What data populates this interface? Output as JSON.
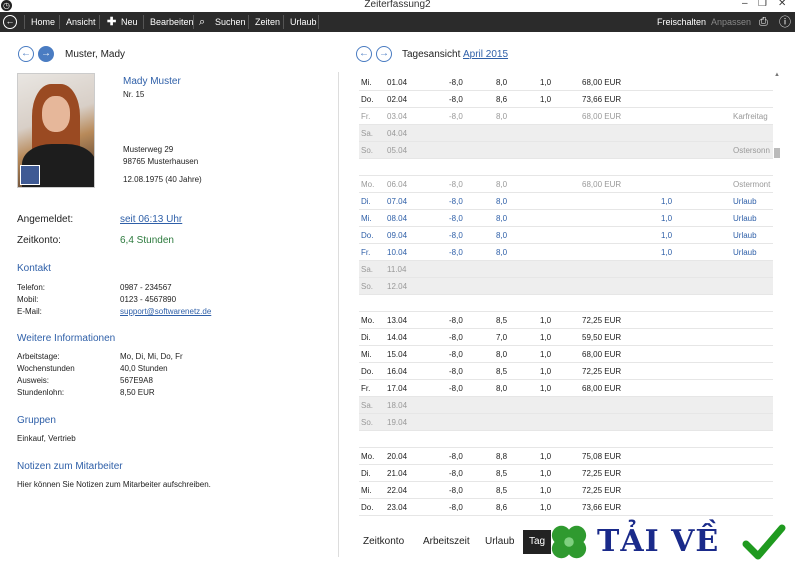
{
  "window": {
    "title": "Zeiterfassung2",
    "app_icon": "clock-icon"
  },
  "toolbar": {
    "items": [
      "Home",
      "Ansicht",
      "Neu",
      "Bearbeiten",
      "Suchen",
      "Zeiten",
      "Urlaub"
    ],
    "right": [
      "Freischalten",
      "Anpassen"
    ]
  },
  "employee": {
    "name_header": "Muster, Mady",
    "display_name": "Mady Muster",
    "number": "Nr. 15",
    "street": "Musterweg 29",
    "city": "98765 Musterhausen",
    "birthday": "12.08.1975 (40 Jahre)",
    "logged_in_label": "Angemeldet:",
    "logged_in_value": "seit 06:13 Uhr",
    "account_label": "Zeitkonto:",
    "account_value": "6,4 Stunden"
  },
  "contact": {
    "heading": "Kontakt",
    "phone_label": "Telefon:",
    "phone": "0987 - 234567",
    "mobile_label": "Mobil:",
    "mobile": "0123 - 4567890",
    "email_label": "E-Mail:",
    "email": "support@softwarenetz.de"
  },
  "info": {
    "heading": "Weitere Informationen",
    "days_label": "Arbeitstage:",
    "days": "Mo, Di, Mi, Do, Fr",
    "hours_label": "Wochenstunden",
    "hours": "40,0 Stunden",
    "id_label": "Ausweis:",
    "id": "567E9A8",
    "wage_label": "Stundenlohn:",
    "wage": "8,50 EUR"
  },
  "groups": {
    "heading": "Gruppen",
    "value": "Einkauf, Vertrieb"
  },
  "notes": {
    "heading": "Notizen zum Mitarbeiter",
    "value": "Hier können Sie Notizen zum Mitarbeiter aufschreiben."
  },
  "dayview": {
    "label": "Tagesansicht",
    "month": "April 2015"
  },
  "rows": [
    {
      "d": "Mi.",
      "date": "01.04",
      "a": "-8,0",
      "b": "8,0",
      "c": "1,0",
      "e": "",
      "amt": "68,00 EUR",
      "note": "",
      "kind": ""
    },
    {
      "d": "Do.",
      "date": "02.04",
      "a": "-8,0",
      "b": "8,6",
      "c": "1,0",
      "e": "",
      "amt": "73,66 EUR",
      "note": "",
      "kind": ""
    },
    {
      "d": "Fr.",
      "date": "03.04",
      "a": "-8,0",
      "b": "8,0",
      "c": "",
      "e": "",
      "amt": "68,00 EUR",
      "note": "Karfreitag",
      "kind": "hol"
    },
    {
      "d": "Sa.",
      "date": "04.04",
      "a": "",
      "b": "",
      "c": "",
      "e": "",
      "amt": "",
      "note": "",
      "kind": "we"
    },
    {
      "d": "So.",
      "date": "05.04",
      "a": "",
      "b": "",
      "c": "",
      "e": "",
      "amt": "",
      "note": "Ostersonn",
      "kind": "we"
    },
    {
      "d": "Mo.",
      "date": "06.04",
      "a": "-8,0",
      "b": "8,0",
      "c": "",
      "e": "",
      "amt": "68,00 EUR",
      "note": "Ostermont",
      "kind": "hol"
    },
    {
      "d": "Di.",
      "date": "07.04",
      "a": "-8,0",
      "b": "8,0",
      "c": "",
      "e": "1,0",
      "amt": "",
      "note": "Urlaub",
      "kind": "urlaub"
    },
    {
      "d": "Mi.",
      "date": "08.04",
      "a": "-8,0",
      "b": "8,0",
      "c": "",
      "e": "1,0",
      "amt": "",
      "note": "Urlaub",
      "kind": "urlaub"
    },
    {
      "d": "Do.",
      "date": "09.04",
      "a": "-8,0",
      "b": "8,0",
      "c": "",
      "e": "1,0",
      "amt": "",
      "note": "Urlaub",
      "kind": "urlaub"
    },
    {
      "d": "Fr.",
      "date": "10.04",
      "a": "-8,0",
      "b": "8,0",
      "c": "",
      "e": "1,0",
      "amt": "",
      "note": "Urlaub",
      "kind": "urlaub"
    },
    {
      "d": "Sa.",
      "date": "11.04",
      "a": "",
      "b": "",
      "c": "",
      "e": "",
      "amt": "",
      "note": "",
      "kind": "we"
    },
    {
      "d": "So.",
      "date": "12.04",
      "a": "",
      "b": "",
      "c": "",
      "e": "",
      "amt": "",
      "note": "",
      "kind": "we"
    },
    {
      "d": "Mo.",
      "date": "13.04",
      "a": "-8,0",
      "b": "8,5",
      "c": "1,0",
      "e": "",
      "amt": "72,25 EUR",
      "note": "",
      "kind": ""
    },
    {
      "d": "Di.",
      "date": "14.04",
      "a": "-8,0",
      "b": "7,0",
      "c": "1,0",
      "e": "",
      "amt": "59,50 EUR",
      "note": "",
      "kind": ""
    },
    {
      "d": "Mi.",
      "date": "15.04",
      "a": "-8,0",
      "b": "8,0",
      "c": "1,0",
      "e": "",
      "amt": "68,00 EUR",
      "note": "",
      "kind": ""
    },
    {
      "d": "Do.",
      "date": "16.04",
      "a": "-8,0",
      "b": "8,5",
      "c": "1,0",
      "e": "",
      "amt": "72,25 EUR",
      "note": "",
      "kind": ""
    },
    {
      "d": "Fr.",
      "date": "17.04",
      "a": "-8,0",
      "b": "8,0",
      "c": "1,0",
      "e": "",
      "amt": "68,00 EUR",
      "note": "",
      "kind": ""
    },
    {
      "d": "Sa.",
      "date": "18.04",
      "a": "",
      "b": "",
      "c": "",
      "e": "",
      "amt": "",
      "note": "",
      "kind": "we"
    },
    {
      "d": "So.",
      "date": "19.04",
      "a": "",
      "b": "",
      "c": "",
      "e": "",
      "amt": "",
      "note": "",
      "kind": "we"
    },
    {
      "d": "Mo.",
      "date": "20.04",
      "a": "-8,0",
      "b": "8,8",
      "c": "1,0",
      "e": "",
      "amt": "75,08 EUR",
      "note": "",
      "kind": ""
    },
    {
      "d": "Di.",
      "date": "21.04",
      "a": "-8,0",
      "b": "8,5",
      "c": "1,0",
      "e": "",
      "amt": "72,25 EUR",
      "note": "",
      "kind": ""
    },
    {
      "d": "Mi.",
      "date": "22.04",
      "a": "-8,0",
      "b": "8,5",
      "c": "1,0",
      "e": "",
      "amt": "72,25 EUR",
      "note": "",
      "kind": ""
    },
    {
      "d": "Do.",
      "date": "23.04",
      "a": "-8,0",
      "b": "8,6",
      "c": "1,0",
      "e": "",
      "amt": "73,66 EUR",
      "note": "",
      "kind": ""
    }
  ],
  "tabs": [
    "Zeitkonto",
    "Arbeitszeit",
    "Urlaub",
    "Tag"
  ],
  "watermark": {
    "text": "TẢI VỀ"
  }
}
